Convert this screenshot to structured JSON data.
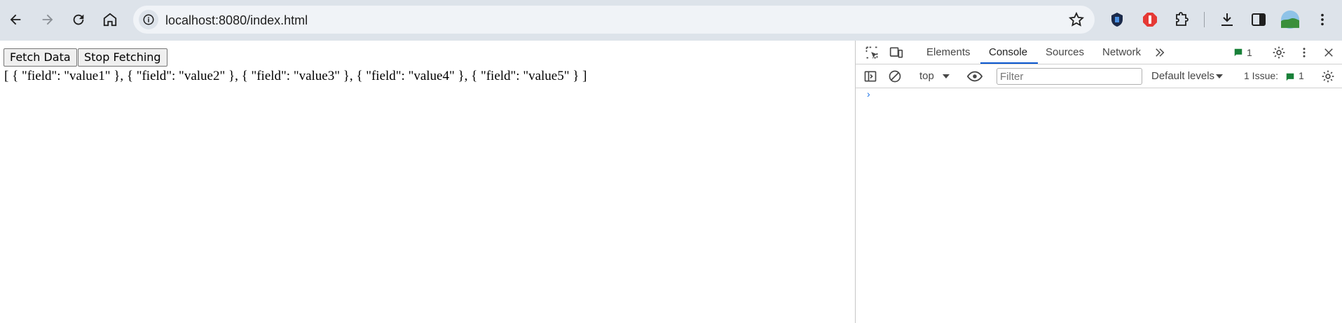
{
  "browser": {
    "url": "localhost:8080/index.html"
  },
  "page": {
    "fetch_button": "Fetch Data",
    "stop_button": "Stop Fetching",
    "output_text": "[ { \"field\": \"value1\" }, { \"field\": \"value2\" }, { \"field\": \"value3\" }, { \"field\": \"value4\" }, { \"field\": \"value5\" } ]"
  },
  "devtools": {
    "tabs": [
      "Elements",
      "Console",
      "Sources",
      "Network"
    ],
    "active_tab": "Console",
    "message_count": "1",
    "context": "top",
    "filter_placeholder": "Filter",
    "levels": "Default levels",
    "issues_label": "1 Issue:",
    "issues_count": "1",
    "prompt_symbol": "›"
  },
  "colors": {
    "toolbar_bg": "#dde3ea",
    "accent": "#0b57d0"
  }
}
